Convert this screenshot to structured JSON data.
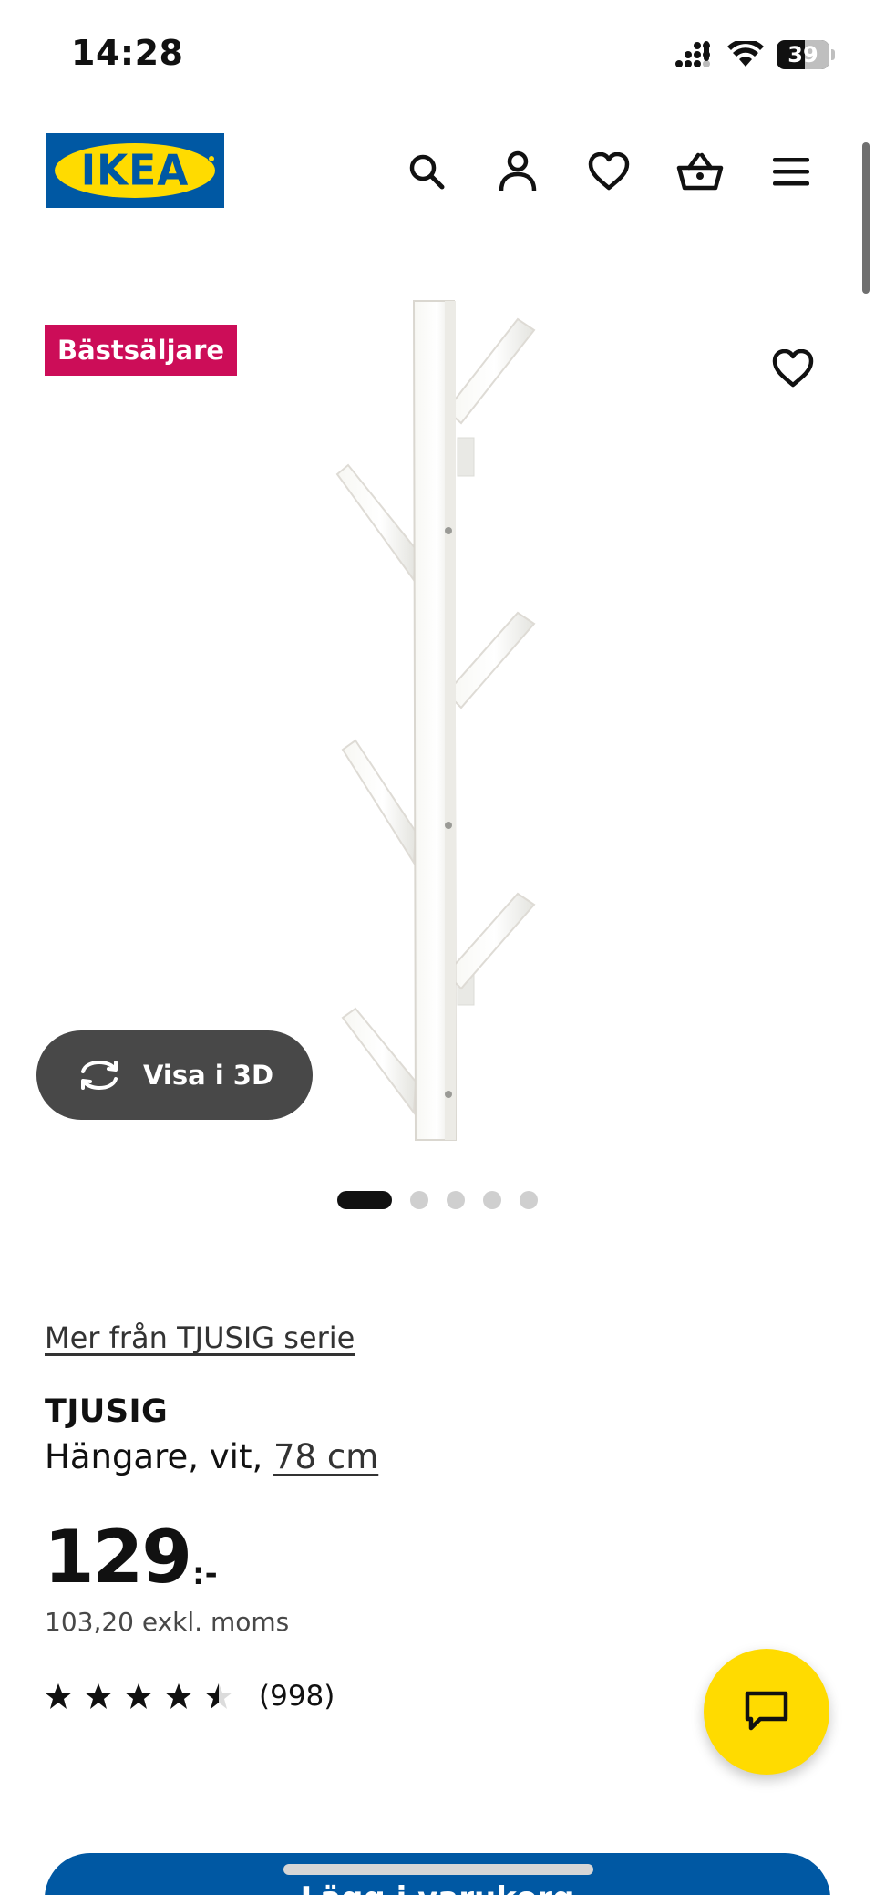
{
  "status_bar": {
    "time": "14:28",
    "battery": "39",
    "icons": [
      "cellular-signal-icon",
      "wifi-icon",
      "battery-icon"
    ]
  },
  "header": {
    "logo_text": "IKEA",
    "icons": [
      "search-icon",
      "account-icon",
      "favorites-icon",
      "basket-icon",
      "menu-icon"
    ]
  },
  "product_image": {
    "badge": "Bästsäljare",
    "view3d_label": "Visa i 3D",
    "carousel_total": 5,
    "carousel_active": 1
  },
  "product": {
    "series_link": "Mer från TJUSIG serie",
    "name": "TJUSIG",
    "description_prefix": "Hängare, vit,",
    "size_link": "78 cm",
    "price": "129",
    "price_suffix": ":-",
    "price_excl_vat": "103,20 exkl. moms",
    "rating": 4.5,
    "rating_max": 5,
    "review_count": "(998)"
  },
  "actions": {
    "buy_label": "Lägg i varukorg"
  },
  "colors": {
    "ikea_blue": "#0058a3",
    "ikea_yellow": "#ffdb00",
    "badge_red": "#cc0d58",
    "view3d_bg": "#484848"
  }
}
